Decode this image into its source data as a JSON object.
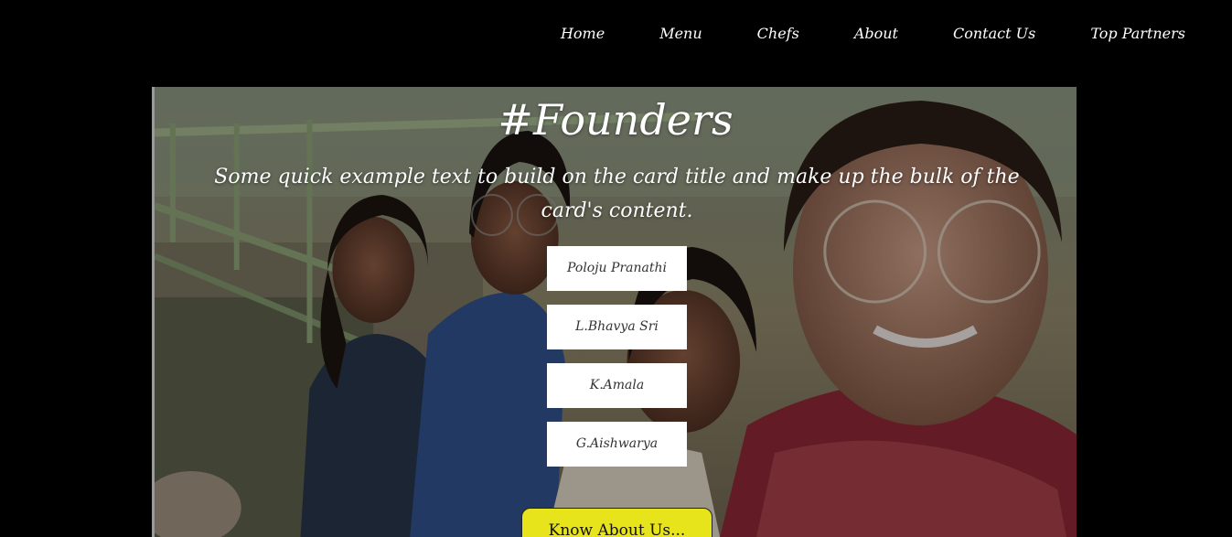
{
  "nav": {
    "items": [
      {
        "label": "Home"
      },
      {
        "label": "Menu"
      },
      {
        "label": "Chefs"
      },
      {
        "label": "About"
      },
      {
        "label": "Contact Us"
      },
      {
        "label": "Top Partners"
      }
    ]
  },
  "hero": {
    "title": "#Founders",
    "text": "Some quick example text to build on the card title and make up the bulk of the card's content.",
    "founders": [
      {
        "name": "Poloju Pranathi"
      },
      {
        "name": "L.Bhavya Sri"
      },
      {
        "name": "K.Amala"
      },
      {
        "name": "G.Aishwarya"
      }
    ],
    "cta_label": "Know About Us..."
  },
  "colors": {
    "background": "#000000",
    "nav_text": "#ffffff",
    "founder_button_bg": "#ffffff",
    "cta_bg": "#e8e41c"
  }
}
